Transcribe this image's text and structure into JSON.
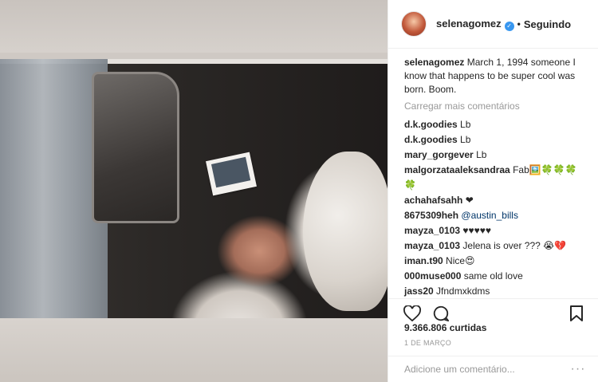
{
  "header": {
    "username": "selenagomez",
    "verified_icon": "verified-badge-icon",
    "separator": "•",
    "follow_label": "Seguindo"
  },
  "caption": {
    "username": "selenagomez",
    "text": "March 1, 1994 someone I know that happens to be super cool was born. Boom."
  },
  "load_more": "Carregar mais comentários",
  "comments": [
    {
      "user": "d.k.goodies",
      "text": "Lb"
    },
    {
      "user": "d.k.goodies",
      "text": "Lb"
    },
    {
      "user": "mary_gorgever",
      "text": "Lb"
    },
    {
      "user": "malgorzataaleksandraa",
      "text": "Fab🖼️🍀🍀🍀"
    },
    {
      "user": "",
      "text": "🍀"
    },
    {
      "user": "achahafsahh",
      "text": "❤"
    },
    {
      "user": "8675309heh",
      "text": "@austin_bills"
    },
    {
      "user": "mayza_0103",
      "text": "♥♥♥♥♥"
    },
    {
      "user": "mayza_0103",
      "text": "Jelena is over ??? 😭💔"
    },
    {
      "user": "iman.t90",
      "text": "Nice😍"
    },
    {
      "user": "000muse000",
      "text": "same old love"
    },
    {
      "user": "jass20",
      "text": "Jfndmxkdms"
    }
  ],
  "actions": {
    "like_icon": "heart-icon",
    "comment_icon": "comment-icon",
    "save_icon": "bookmark-icon"
  },
  "likes": "9.366.806 curtidas",
  "date": "1 DE MARÇO",
  "add_comment": {
    "placeholder": "Adicione um comentário...",
    "more_icon": "more-icon",
    "more_glyph": "···"
  },
  "colors": {
    "verified": "#3897f0",
    "muted": "#999999",
    "text": "#262626",
    "mention": "#003569"
  }
}
